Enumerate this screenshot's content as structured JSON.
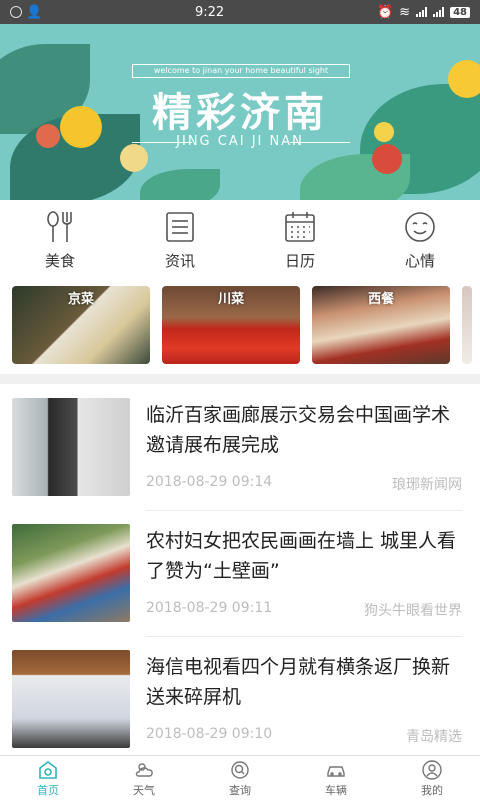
{
  "status_bar": {
    "time": "9:22",
    "battery": "48"
  },
  "banner": {
    "subtitle": "welcome to jinan your home beautiful sight",
    "title": "精彩济南",
    "pinyin": "JING CAI JI NAN"
  },
  "categories": [
    {
      "label": "美食",
      "icon": "fork-knife-icon"
    },
    {
      "label": "资讯",
      "icon": "news-list-icon"
    },
    {
      "label": "日历",
      "icon": "calendar-icon"
    },
    {
      "label": "心情",
      "icon": "smiley-icon"
    }
  ],
  "cuisines": [
    {
      "label": "京菜",
      "color": "#3b4a3a"
    },
    {
      "label": "川菜",
      "color": "#b8261d"
    },
    {
      "label": "西餐",
      "color": "#c89070"
    }
  ],
  "news": [
    {
      "headline": "临沂百家画廊展示交易会中国画学术邀请展布展完成",
      "time": "2018-08-29 09:14",
      "source": "琅琊新闻网"
    },
    {
      "headline": "农村妇女把农民画画在墙上 城里人看了赞为“土壁画”",
      "time": "2018-08-29 09:11",
      "source": "狗头牛眼看世界"
    },
    {
      "headline": "海信电视看四个月就有横条返厂换新送来碎屏机",
      "time": "2018-08-29 09:10",
      "source": "青岛精选"
    }
  ],
  "tabs": [
    {
      "label": "首页",
      "icon": "home-icon",
      "active": true
    },
    {
      "label": "天气",
      "icon": "weather-icon",
      "active": false
    },
    {
      "label": "查询",
      "icon": "search-icon",
      "active": false
    },
    {
      "label": "车辆",
      "icon": "car-icon",
      "active": false
    },
    {
      "label": "我的",
      "icon": "user-icon",
      "active": false
    }
  ],
  "colors": {
    "accent": "#33b3b7",
    "banner_bg": "#79c9c4"
  }
}
